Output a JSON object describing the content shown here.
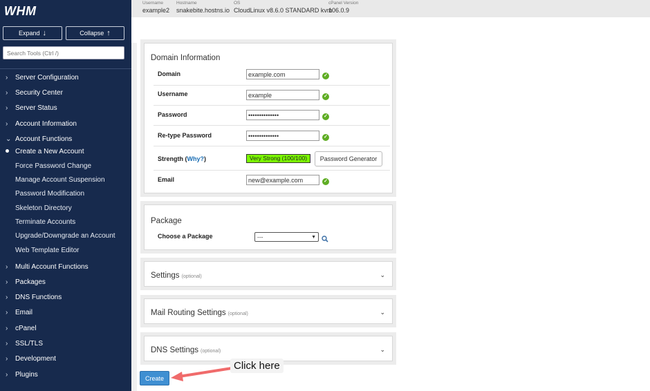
{
  "sidebar": {
    "logo": "WHM",
    "expand_label": "Expand",
    "collapse_label": "Collapse",
    "search_placeholder": "Search Tools (Ctrl /)",
    "items": [
      {
        "label": "Server Configuration"
      },
      {
        "label": "Security Center"
      },
      {
        "label": "Server Status"
      },
      {
        "label": "Account Information"
      },
      {
        "label": "Account Functions"
      }
    ],
    "sub_items": [
      {
        "label": "Create a New Account"
      },
      {
        "label": "Force Password Change"
      },
      {
        "label": "Manage Account Suspension"
      },
      {
        "label": "Password Modification"
      },
      {
        "label": "Skeleton Directory"
      },
      {
        "label": "Terminate Accounts"
      },
      {
        "label": "Upgrade/Downgrade an Account"
      },
      {
        "label": "Web Template Editor"
      }
    ],
    "items_after": [
      {
        "label": "Multi Account Functions"
      },
      {
        "label": "Packages"
      },
      {
        "label": "DNS Functions"
      },
      {
        "label": "Email"
      },
      {
        "label": "cPanel"
      },
      {
        "label": "SSL/TLS"
      },
      {
        "label": "Development"
      },
      {
        "label": "Plugins"
      }
    ]
  },
  "topbar": {
    "username_label": "Username",
    "username": "example2",
    "hostname_label": "Hostname",
    "hostname": "snakebite.hostns.io",
    "os_label": "OS",
    "os": "CloudLinux v8.6.0 STANDARD kvm",
    "version_label": "cPanel Version",
    "version": "106.0.9"
  },
  "domain_info": {
    "title": "Domain Information",
    "domain_label": "Domain",
    "domain_value": "example.com",
    "username_label": "Username",
    "username_value": "example",
    "password_label": "Password",
    "password_value": "••••••••••••••",
    "retype_label": "Re-type Password",
    "retype_value": "••••••••••••••",
    "strength_label": "Strength (",
    "strength_why": "Why?",
    "strength_close": ")",
    "strength_value": "Very Strong (100/100)",
    "password_generator": "Password Generator",
    "email_label": "Email",
    "email_value": "new@example.com"
  },
  "package": {
    "title": "Package",
    "choose_label": "Choose a Package",
    "selected": "---"
  },
  "sections": {
    "settings": "Settings",
    "mail_routing": "Mail Routing Settings",
    "dns_settings": "DNS Settings",
    "optional": "(optional)"
  },
  "create_button": "Create",
  "callout": "Click here",
  "colors": {
    "sidebar_bg": "#172a4d",
    "create_btn": "#3f8fd2",
    "strength_bg": "#7cfc00",
    "check": "#5fad24",
    "arrow": "#f06b6b"
  }
}
